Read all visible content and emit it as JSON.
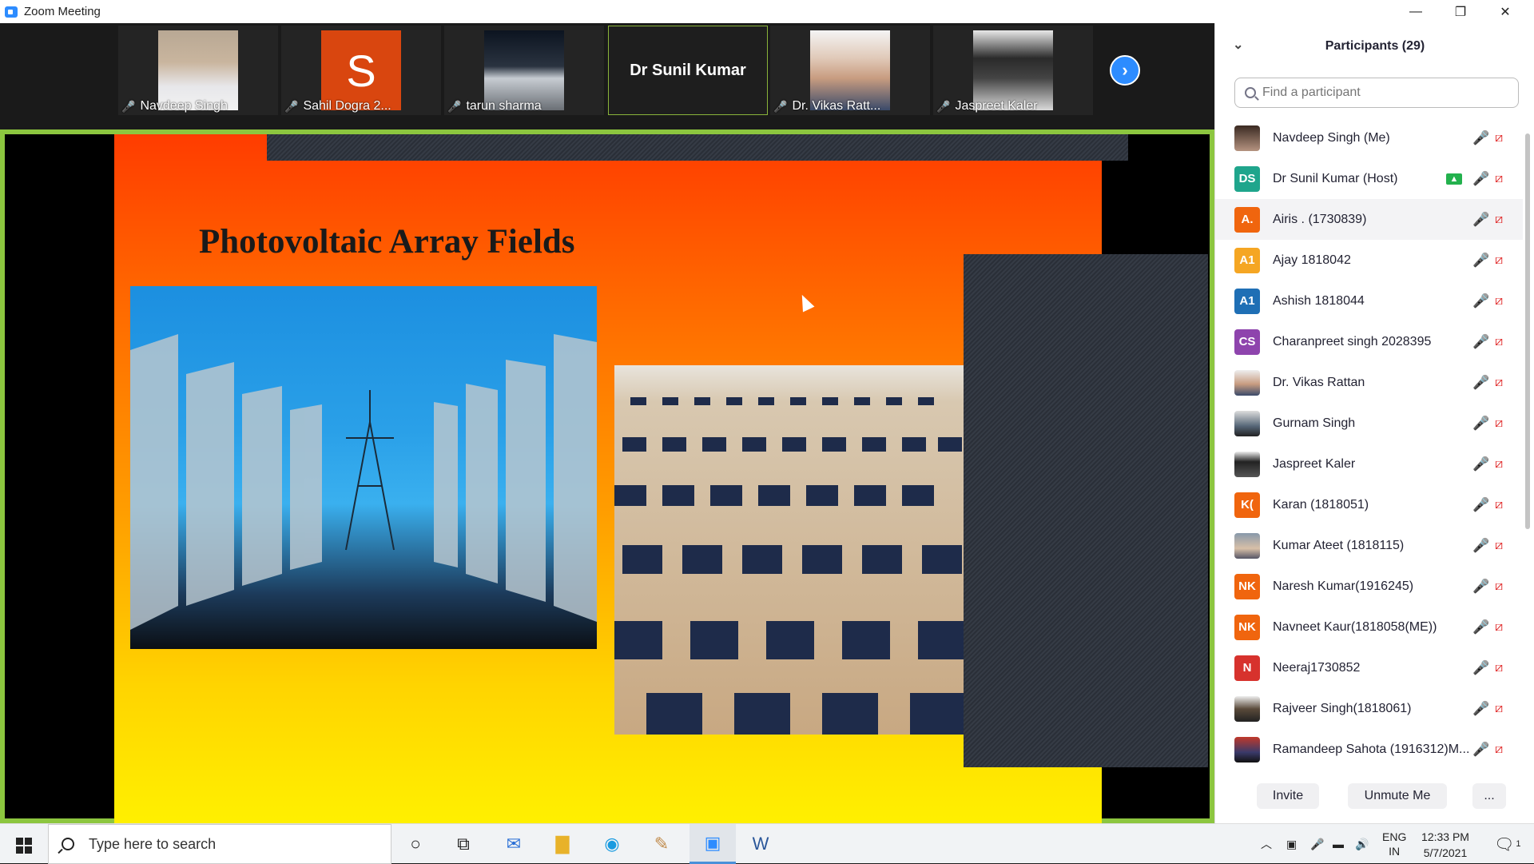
{
  "window": {
    "title": "Zoom Meeting",
    "min": "—",
    "max": "❐",
    "close": "✕"
  },
  "strip": {
    "tiles": [
      {
        "name": "Navdeep Singh"
      },
      {
        "name": "Sahil Dogra 2...",
        "initial": "S"
      },
      {
        "name": "tarun sharma"
      },
      {
        "name": "Dr Sunil Kumar"
      },
      {
        "name": "Dr. Vikas Ratt..."
      },
      {
        "name": "Jaspreet Kaler"
      }
    ],
    "next": "›"
  },
  "slide": {
    "title": "Photovoltaic Array Fields"
  },
  "panel": {
    "title": "Participants (29)",
    "search_placeholder": "Find a participant",
    "participants": [
      {
        "name": "Navdeep Singh (Me)",
        "initials": "",
        "color": "#6b4a3a"
      },
      {
        "name": "Dr Sunil Kumar (Host)",
        "initials": "DS",
        "color": "#1fa58c"
      },
      {
        "name": "Airis . (1730839)",
        "initials": "A.",
        "color": "#f0650e"
      },
      {
        "name": "Ajay 1818042",
        "initials": "A1",
        "color": "#f5a623"
      },
      {
        "name": "Ashish 1818044",
        "initials": "A1",
        "color": "#1f6fb5"
      },
      {
        "name": "Charanpreet singh 2028395",
        "initials": "CS",
        "color": "#8e44ad"
      },
      {
        "name": "Dr. Vikas Rattan",
        "initials": "",
        "color": "#b9b9b9"
      },
      {
        "name": "Gurnam Singh",
        "initials": "",
        "color": "#7a8a99"
      },
      {
        "name": "Jaspreet Kaler",
        "initials": "",
        "color": "#333333"
      },
      {
        "name": "Karan (1818051)",
        "initials": "K(",
        "color": "#f0650e"
      },
      {
        "name": "Kumar Ateet (1818115)",
        "initials": "",
        "color": "#8899aa"
      },
      {
        "name": "Naresh Kumar(1916245)",
        "initials": "NK",
        "color": "#f0650e"
      },
      {
        "name": "Navneet Kaur(1818058(ME))",
        "initials": "NK",
        "color": "#f0650e"
      },
      {
        "name": "Neeraj1730852",
        "initials": "N",
        "color": "#d7322d"
      },
      {
        "name": "Rajveer Singh(1818061)",
        "initials": "",
        "color": "#5a4a3a"
      },
      {
        "name": "Ramandeep Sahota (1916312)M...",
        "initials": "",
        "color": "#3a3a6a"
      }
    ],
    "invite": "Invite",
    "unmute": "Unmute Me",
    "more": "..."
  },
  "taskbar": {
    "search_text": "Type here to search",
    "lang": "ENG",
    "region": "IN",
    "time": "12:33 PM",
    "date": "5/7/2021",
    "notif_count": "1"
  }
}
